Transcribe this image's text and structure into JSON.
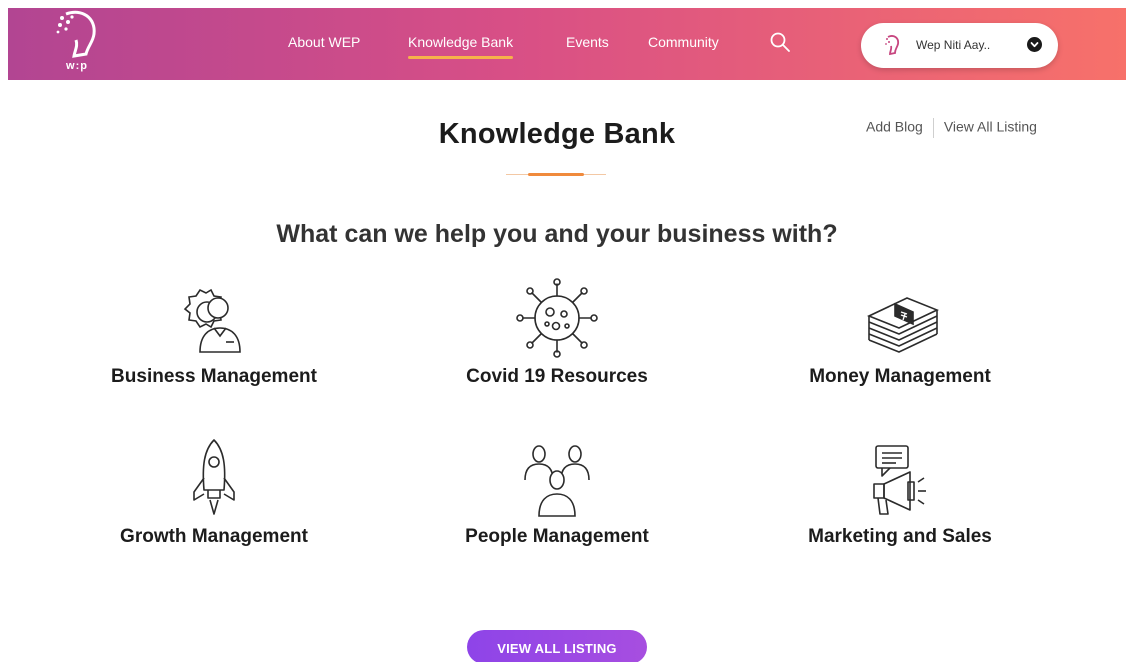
{
  "header": {
    "logo_text": "w:p",
    "nav": [
      {
        "label": "About WEP"
      },
      {
        "label": "Knowledge Bank",
        "active": true
      },
      {
        "label": "Events"
      },
      {
        "label": "Community"
      }
    ],
    "user_name": "Wep Niti Aay..",
    "gradient": [
      "#b24592",
      "#f7716a"
    ]
  },
  "page": {
    "title": "Knowledge Bank",
    "links": {
      "add_blog": "Add Blog",
      "view_all": "View All Listing"
    },
    "subtitle": "What can we help you and your business with?",
    "accent": "#f08a3c"
  },
  "categories": [
    {
      "label": "Business Management",
      "icon": "business-management-icon"
    },
    {
      "label": "Covid 19 Resources",
      "icon": "covid-virus-icon"
    },
    {
      "label": "Money Management",
      "icon": "money-stack-icon"
    },
    {
      "label": "Growth Management",
      "icon": "rocket-icon"
    },
    {
      "label": "People Management",
      "icon": "people-icon"
    },
    {
      "label": "Marketing and Sales",
      "icon": "megaphone-icon"
    }
  ],
  "cta": {
    "label": "VIEW ALL LISTING",
    "color": "#8e44e8"
  }
}
